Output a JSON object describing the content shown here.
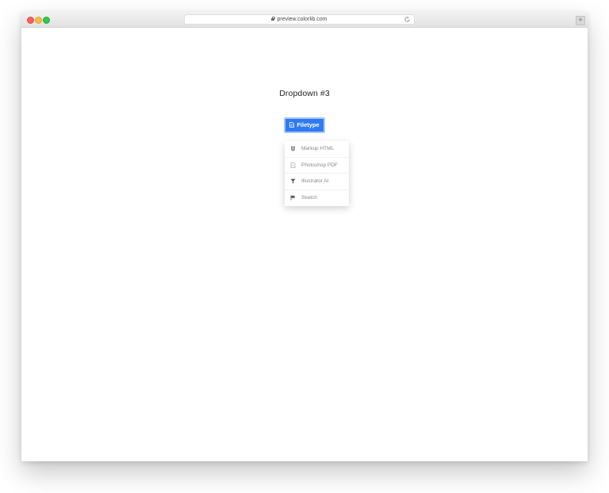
{
  "browser": {
    "url": "preview.colorlib.com",
    "new_tab_symbol": "+"
  },
  "page": {
    "heading": "Dropdown #3"
  },
  "dropdown": {
    "button_label": "Filetype",
    "button_icon": "file-icon",
    "accent_color": "#2f7af0",
    "items": [
      {
        "label": "Markup HTML",
        "icon": "html5-icon"
      },
      {
        "label": "Photoshop PDF",
        "icon": "file-pdf-icon"
      },
      {
        "label": "Illustrator AI",
        "icon": "filter-icon"
      },
      {
        "label": "Sketch",
        "icon": "flag-icon"
      }
    ]
  }
}
